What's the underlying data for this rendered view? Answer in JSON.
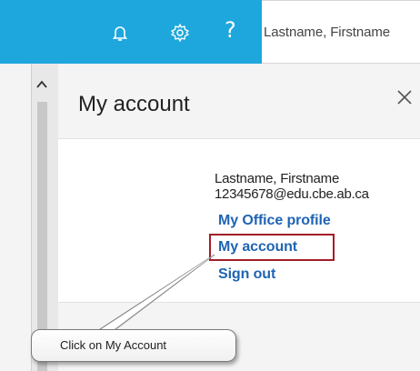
{
  "topbar": {
    "accent": "#1ea7dc",
    "icons": [
      "bell-icon",
      "gear-icon",
      "help-icon"
    ],
    "help_glyph": "?",
    "user_name": "Lastname, Firstname"
  },
  "panel": {
    "title": "My account",
    "close_icon": "close-icon"
  },
  "account": {
    "name": "Lastname, Firstname",
    "email": "12345678@edu.cbe.ab.ca",
    "links": {
      "office_profile": "My Office profile",
      "my_account": "My account",
      "sign_out": "Sign out"
    },
    "link_color": "#1f64b4",
    "highlight_color": "#a31d27"
  },
  "callout": {
    "text": "Click on My Account"
  }
}
